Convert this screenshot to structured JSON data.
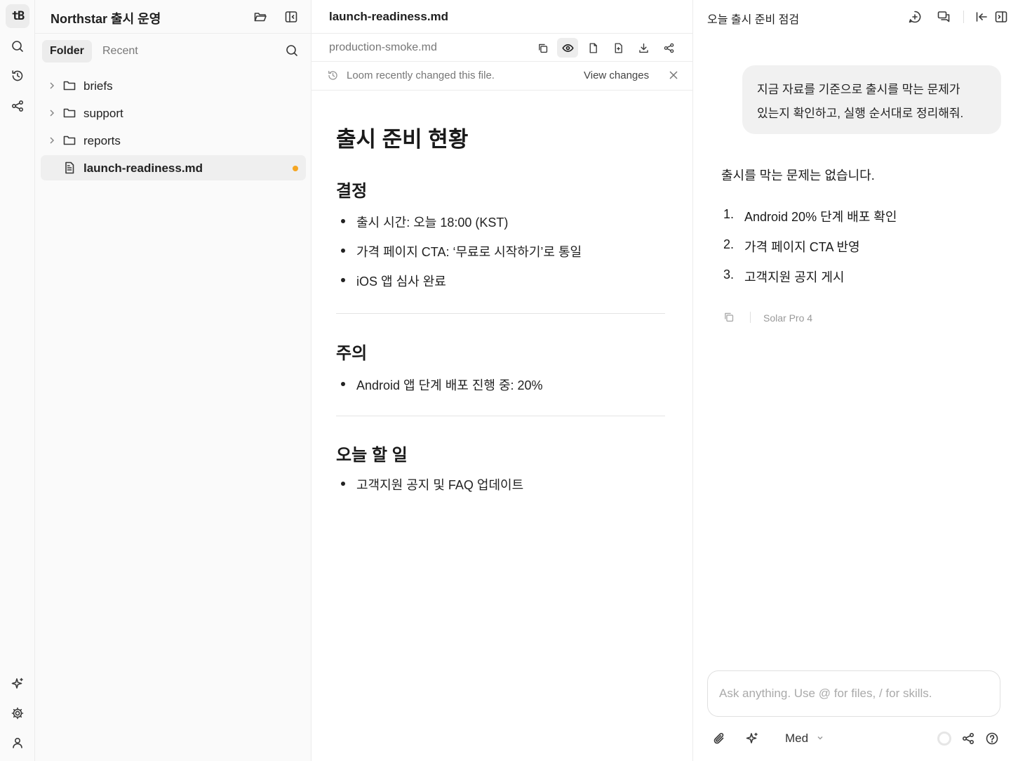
{
  "rail": {
    "logo": "tB",
    "icons": [
      "search-icon",
      "history-icon",
      "share-graph-icon",
      "sparkle-icon",
      "gear-icon",
      "user-icon"
    ]
  },
  "sidebar": {
    "title": "Northstar 출시 운영",
    "tabs": [
      {
        "label": "Folder",
        "active": true
      },
      {
        "label": "Recent",
        "active": false
      }
    ],
    "items": [
      {
        "label": "briefs",
        "type": "folder"
      },
      {
        "label": "support",
        "type": "folder"
      },
      {
        "label": "reports",
        "type": "folder"
      },
      {
        "label": "launch-readiness.md",
        "type": "file",
        "selected": true,
        "modified": true
      }
    ]
  },
  "editor": {
    "title": "launch-readiness.md",
    "subfile": "production-smoke.md",
    "notice": {
      "text": "Loom recently changed this file.",
      "link": "View changes"
    },
    "doc": {
      "h1": "출시 준비 현황",
      "sections": [
        {
          "heading": "결정",
          "items": [
            "출시 시간:  오늘 18:00 (KST)",
            "가격 페이지 CTA: ‘무료로 시작하기’로 통일",
            "iOS 앱 심사 완료"
          ]
        },
        {
          "heading": "주의",
          "items": [
            "Android 앱 단계 배포 진행 중: 20%"
          ]
        },
        {
          "heading": "오늘 할 일",
          "items": [
            "고객지원 공지 및 FAQ 업데이트"
          ]
        }
      ]
    }
  },
  "chat": {
    "title": "오늘 출시 준비 점검",
    "user_message": {
      "line1": "지금 자료를 기준으로 출시를 막는 문제가",
      "line2": "있는지 확인하고, 실행 순서대로 정리해줘."
    },
    "answer": {
      "headline": "출시를 막는 문제는 없습니다.",
      "steps": [
        {
          "num": "1.",
          "text": "Android 20% 단계 배포 확인"
        },
        {
          "num": "2.",
          "text": "가격 페이지 CTA 반영"
        },
        {
          "num": "3.",
          "text": "고객지원 공지 게시"
        }
      ],
      "model": "Solar Pro 4"
    },
    "composer": {
      "placeholder": "Ask anything. Use @ for files, / for skills.",
      "value": "",
      "effort": "Med"
    }
  },
  "colors": {
    "accent_dot": "#f5a623",
    "panel_bg": "#fafafa",
    "border": "#ececec"
  }
}
